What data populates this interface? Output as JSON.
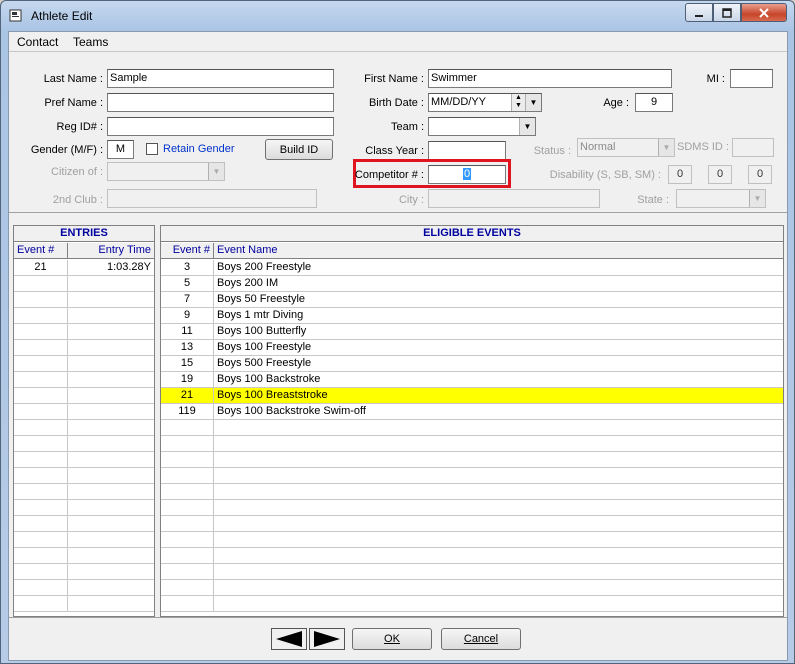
{
  "window": {
    "title": "Athlete Edit",
    "min": "0",
    "max": "1",
    "close": "r"
  },
  "menu": {
    "items": [
      {
        "label": "Contact"
      },
      {
        "label": "Teams"
      }
    ]
  },
  "form": {
    "last_name": {
      "label": "Last Name :",
      "value": "Sample"
    },
    "first_name": {
      "label": "First Name :",
      "value": "Swimmer"
    },
    "mi": {
      "label": "MI :",
      "value": ""
    },
    "pref_name": {
      "label": "Pref Name :",
      "value": ""
    },
    "birth_date": {
      "label": "Birth Date :",
      "value": "MM/DD/YY"
    },
    "age": {
      "label": "Age :",
      "value": "9"
    },
    "reg_id": {
      "label": "Reg ID# :",
      "value": ""
    },
    "team": {
      "label": "Team :",
      "value": ""
    },
    "gender": {
      "label": "Gender (M/F) :",
      "value": "M"
    },
    "retain_gender": {
      "label": "Retain Gender",
      "checked": false
    },
    "build_id": {
      "label": "Build ID"
    },
    "class_year": {
      "label": "Class Year :",
      "value": ""
    },
    "status": {
      "label": "Status :",
      "value": "Normal"
    },
    "sdms_id": {
      "label": "SDMS ID :",
      "value": ""
    },
    "citizen_of": {
      "label": "Citizen of :",
      "value": ""
    },
    "competitor": {
      "label": "Competitor # :",
      "value": "0"
    },
    "disability": {
      "label": "Disability (S, SB, SM) :",
      "values": [
        "0",
        "0",
        "0"
      ]
    },
    "second_club": {
      "label": "2nd Club :",
      "value": ""
    },
    "city": {
      "label": "City :",
      "value": ""
    },
    "state": {
      "label": "State :",
      "value": ""
    }
  },
  "entries": {
    "title": "ENTRIES",
    "columns": [
      "Event #",
      "Entry Time"
    ],
    "rows": [
      {
        "event": "21",
        "time": "1:03.28Y"
      }
    ]
  },
  "eligible": {
    "title": "ELIGIBLE EVENTS",
    "columns": [
      "Event #",
      "Event Name"
    ],
    "rows": [
      {
        "event": "3",
        "name": "Boys 200 Freestyle"
      },
      {
        "event": "5",
        "name": "Boys 200 IM"
      },
      {
        "event": "7",
        "name": "Boys 50 Freestyle"
      },
      {
        "event": "9",
        "name": "Boys 1 mtr Diving"
      },
      {
        "event": "11",
        "name": "Boys 100 Butterfly"
      },
      {
        "event": "13",
        "name": "Boys 100 Freestyle"
      },
      {
        "event": "15",
        "name": "Boys 500 Freestyle"
      },
      {
        "event": "19",
        "name": "Boys 100 Backstroke"
      },
      {
        "event": "21",
        "name": "Boys 100 Breaststroke",
        "selected": true
      },
      {
        "event": "119",
        "name": "Boys 100 Backstroke Swim-off"
      }
    ]
  },
  "footer": {
    "ok": "OK",
    "cancel": "Cancel"
  },
  "colors": {
    "highlight_box": "#e0141e",
    "selected_row": "#ffff00",
    "blue_label": "#0033cc"
  }
}
